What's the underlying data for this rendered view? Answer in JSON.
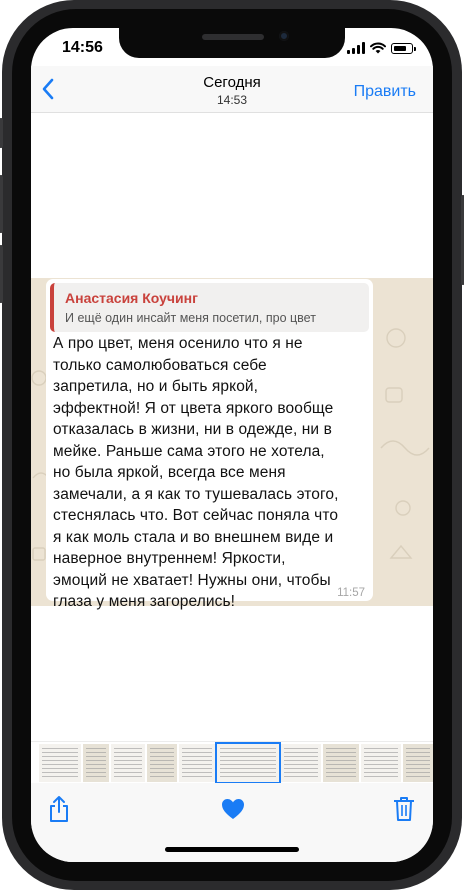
{
  "status_bar": {
    "time": "14:56"
  },
  "nav": {
    "back_icon": "chevron-left-icon",
    "title": "Сегодня",
    "subtitle": "14:53",
    "edit_label": "Править"
  },
  "message": {
    "quote_author": "Анастасия Коучинг",
    "quote_text": "И ещё один инсайт меня посетил, про цвет",
    "lines": [
      "А про цвет, меня осенило что я не",
      "только самолюбоваться себе",
      "запретила, но и быть яркой,",
      "эффектной! Я от цвета яркого вообще",
      "отказалась в жизни, ни в одежде, ни в",
      "мейке. Раньше сама этого не хотела,",
      "но была яркой, всегда все меня",
      "замечали, а я как то тушевалась этого,",
      "стеснялась что. Вот сейчас поняла что",
      "я как моль стала и во внешнем виде и",
      "наверное внутреннем! Яркости,",
      "эмоций не хватает! Нужны они, чтобы",
      "глаза у меня загорелись!"
    ],
    "time": "11:57",
    "accent_color": "#c9423c"
  },
  "toolbar": {
    "share_icon": "share-icon",
    "favorite_icon": "heart-icon",
    "delete_icon": "trash-icon",
    "accent_color": "#1a7cf5"
  }
}
